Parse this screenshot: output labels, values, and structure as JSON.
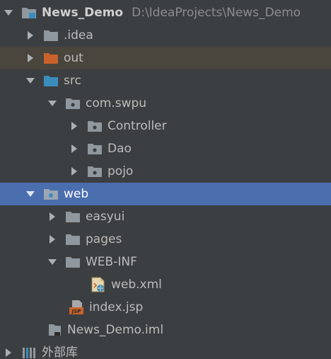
{
  "project_tree": {
    "root": {
      "name": "News_Demo",
      "path": "D:\\IdeaProjects\\News_Demo"
    },
    "idea": ".idea",
    "out": "out",
    "src": "src",
    "package": "com.swpu",
    "controller": "Controller",
    "dao": "Dao",
    "pojo": "pojo",
    "web": "web",
    "easyui": "easyui",
    "pages": "pages",
    "webinf": "WEB-INF",
    "webxml": "web.xml",
    "indexjsp": "index.jsp",
    "iml": "News_Demo.iml",
    "external_libraries": "外部库",
    "jsp_badge": "JSP"
  },
  "colors": {
    "background": "#3c3f41",
    "selected_row": "#4b6eaf",
    "excluded_row": "#4a453d",
    "folder_gray": "#8f989e",
    "folder_orange": "#c8622a",
    "folder_blue": "#3b8dbd",
    "text": "#bbbbbb"
  }
}
